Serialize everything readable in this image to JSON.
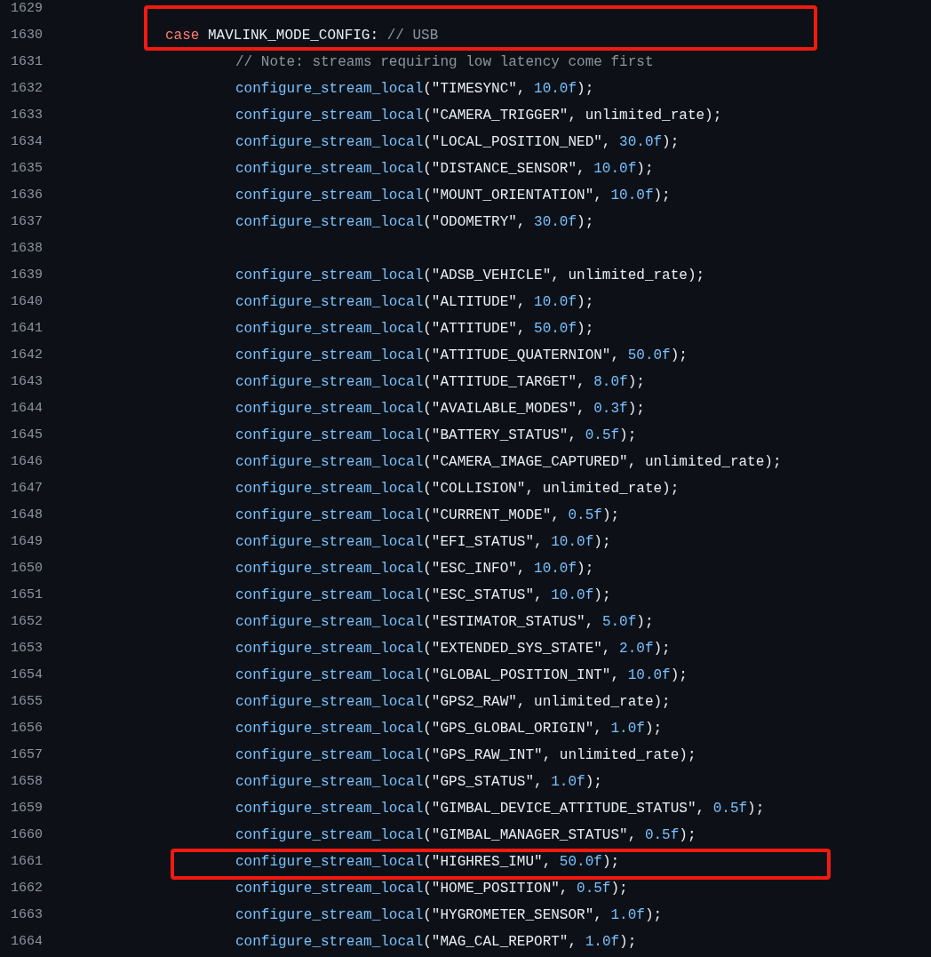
{
  "lines": [
    {
      "number": "1629",
      "highlighted": false
    },
    {
      "number": "1630",
      "highlighted": true,
      "tokens": [
        {
          "kind": "keyword",
          "text": "case"
        },
        {
          "kind": "plain",
          "text": " MAVLINK_MODE_CONFIG: "
        },
        {
          "kind": "comment",
          "text": "// USB"
        }
      ],
      "children": [
        {
          "number": "1631",
          "highlighted": false,
          "tokens": [
            {
              "kind": "comment",
              "text": "// Note: streams requiring low latency come first"
            }
          ]
        },
        {
          "number": "1632",
          "highlighted": false,
          "tokens": [
            {
              "kind": "function",
              "text": "configure_stream_local"
            },
            {
              "kind": "plain",
              "text": "(\"TIMESYNC\", "
            },
            {
              "kind": "number",
              "text": "10.0f"
            },
            {
              "kind": "plain",
              "text": ");"
            }
          ]
        },
        {
          "number": "1633",
          "highlighted": false,
          "tokens": [
            {
              "kind": "function",
              "text": "configure_stream_local"
            },
            {
              "kind": "plain",
              "text": "(\"CAMERA_TRIGGER\", unlimited_rate);"
            }
          ]
        },
        {
          "number": "1634",
          "highlighted": false,
          "tokens": [
            {
              "kind": "function",
              "text": "configure_stream_local"
            },
            {
              "kind": "plain",
              "text": "(\"LOCAL_POSITION_NED\", "
            },
            {
              "kind": "number",
              "text": "30.0f"
            },
            {
              "kind": "plain",
              "text": ");"
            }
          ]
        },
        {
          "number": "1635",
          "highlighted": false,
          "tokens": [
            {
              "kind": "function",
              "text": "configure_stream_local"
            },
            {
              "kind": "plain",
              "text": "(\"DISTANCE_SENSOR\", "
            },
            {
              "kind": "number",
              "text": "10.0f"
            },
            {
              "kind": "plain",
              "text": ");"
            }
          ]
        },
        {
          "number": "1636",
          "highlighted": false,
          "tokens": [
            {
              "kind": "function",
              "text": "configure_stream_local"
            },
            {
              "kind": "plain",
              "text": "(\"MOUNT_ORIENTATION\", "
            },
            {
              "kind": "number",
              "text": "10.0f"
            },
            {
              "kind": "plain",
              "text": ");"
            }
          ]
        },
        {
          "number": "1637",
          "highlighted": false,
          "tokens": [
            {
              "kind": "function",
              "text": "configure_stream_local"
            },
            {
              "kind": "plain",
              "text": "(\"ODOMETRY\", "
            },
            {
              "kind": "number",
              "text": "30.0f"
            },
            {
              "kind": "plain",
              "text": ");"
            }
          ]
        },
        {
          "number": "1638",
          "highlighted": false
        },
        {
          "number": "1639",
          "highlighted": false,
          "tokens": [
            {
              "kind": "function",
              "text": "configure_stream_local"
            },
            {
              "kind": "plain",
              "text": "(\"ADSB_VEHICLE\", unlimited_rate);"
            }
          ]
        },
        {
          "number": "1640",
          "highlighted": false,
          "tokens": [
            {
              "kind": "function",
              "text": "configure_stream_local"
            },
            {
              "kind": "plain",
              "text": "(\"ALTITUDE\", "
            },
            {
              "kind": "number",
              "text": "10.0f"
            },
            {
              "kind": "plain",
              "text": ");"
            }
          ]
        },
        {
          "number": "1641",
          "highlighted": false,
          "tokens": [
            {
              "kind": "function",
              "text": "configure_stream_local"
            },
            {
              "kind": "plain",
              "text": "(\"ATTITUDE\", "
            },
            {
              "kind": "number",
              "text": "50.0f"
            },
            {
              "kind": "plain",
              "text": ");"
            }
          ]
        },
        {
          "number": "1642",
          "highlighted": false,
          "tokens": [
            {
              "kind": "function",
              "text": "configure_stream_local"
            },
            {
              "kind": "plain",
              "text": "(\"ATTITUDE_QUATERNION\", "
            },
            {
              "kind": "number",
              "text": "50.0f"
            },
            {
              "kind": "plain",
              "text": ");"
            }
          ]
        },
        {
          "number": "1643",
          "highlighted": false,
          "tokens": [
            {
              "kind": "function",
              "text": "configure_stream_local"
            },
            {
              "kind": "plain",
              "text": "(\"ATTITUDE_TARGET\", "
            },
            {
              "kind": "number",
              "text": "8.0f"
            },
            {
              "kind": "plain",
              "text": ");"
            }
          ]
        },
        {
          "number": "1644",
          "highlighted": false,
          "tokens": [
            {
              "kind": "function",
              "text": "configure_stream_local"
            },
            {
              "kind": "plain",
              "text": "(\"AVAILABLE_MODES\", "
            },
            {
              "kind": "number",
              "text": "0.3f"
            },
            {
              "kind": "plain",
              "text": ");"
            }
          ]
        },
        {
          "number": "1645",
          "highlighted": false,
          "tokens": [
            {
              "kind": "function",
              "text": "configure_stream_local"
            },
            {
              "kind": "plain",
              "text": "(\"BATTERY_STATUS\", "
            },
            {
              "kind": "number",
              "text": "0.5f"
            },
            {
              "kind": "plain",
              "text": ");"
            }
          ]
        },
        {
          "number": "1646",
          "highlighted": false,
          "tokens": [
            {
              "kind": "function",
              "text": "configure_stream_local"
            },
            {
              "kind": "plain",
              "text": "(\"CAMERA_IMAGE_CAPTURED\", unlimited_rate);"
            }
          ]
        },
        {
          "number": "1647",
          "highlighted": false,
          "tokens": [
            {
              "kind": "function",
              "text": "configure_stream_local"
            },
            {
              "kind": "plain",
              "text": "(\"COLLISION\", unlimited_rate);"
            }
          ]
        },
        {
          "number": "1648",
          "highlighted": false,
          "tokens": [
            {
              "kind": "function",
              "text": "configure_stream_local"
            },
            {
              "kind": "plain",
              "text": "(\"CURRENT_MODE\", "
            },
            {
              "kind": "number",
              "text": "0.5f"
            },
            {
              "kind": "plain",
              "text": ");"
            }
          ]
        },
        {
          "number": "1649",
          "highlighted": false,
          "tokens": [
            {
              "kind": "function",
              "text": "configure_stream_local"
            },
            {
              "kind": "plain",
              "text": "(\"EFI_STATUS\", "
            },
            {
              "kind": "number",
              "text": "10.0f"
            },
            {
              "kind": "plain",
              "text": ");"
            }
          ]
        },
        {
          "number": "1650",
          "highlighted": false,
          "tokens": [
            {
              "kind": "function",
              "text": "configure_stream_local"
            },
            {
              "kind": "plain",
              "text": "(\"ESC_INFO\", "
            },
            {
              "kind": "number",
              "text": "10.0f"
            },
            {
              "kind": "plain",
              "text": ");"
            }
          ]
        },
        {
          "number": "1651",
          "highlighted": false,
          "tokens": [
            {
              "kind": "function",
              "text": "configure_stream_local"
            },
            {
              "kind": "plain",
              "text": "(\"ESC_STATUS\", "
            },
            {
              "kind": "number",
              "text": "10.0f"
            },
            {
              "kind": "plain",
              "text": ");"
            }
          ]
        },
        {
          "number": "1652",
          "highlighted": false,
          "tokens": [
            {
              "kind": "function",
              "text": "configure_stream_local"
            },
            {
              "kind": "plain",
              "text": "(\"ESTIMATOR_STATUS\", "
            },
            {
              "kind": "number",
              "text": "5.0f"
            },
            {
              "kind": "plain",
              "text": ");"
            }
          ]
        },
        {
          "number": "1653",
          "highlighted": false,
          "tokens": [
            {
              "kind": "function",
              "text": "configure_stream_local"
            },
            {
              "kind": "plain",
              "text": "(\"EXTENDED_SYS_STATE\", "
            },
            {
              "kind": "number",
              "text": "2.0f"
            },
            {
              "kind": "plain",
              "text": ");"
            }
          ]
        },
        {
          "number": "1654",
          "highlighted": false,
          "tokens": [
            {
              "kind": "function",
              "text": "configure_stream_local"
            },
            {
              "kind": "plain",
              "text": "(\"GLOBAL_POSITION_INT\", "
            },
            {
              "kind": "number",
              "text": "10.0f"
            },
            {
              "kind": "plain",
              "text": ");"
            }
          ]
        },
        {
          "number": "1655",
          "highlighted": false,
          "tokens": [
            {
              "kind": "function",
              "text": "configure_stream_local"
            },
            {
              "kind": "plain",
              "text": "(\"GPS2_RAW\", unlimited_rate);"
            }
          ]
        },
        {
          "number": "1656",
          "highlighted": false,
          "tokens": [
            {
              "kind": "function",
              "text": "configure_stream_local"
            },
            {
              "kind": "plain",
              "text": "(\"GPS_GLOBAL_ORIGIN\", "
            },
            {
              "kind": "number",
              "text": "1.0f"
            },
            {
              "kind": "plain",
              "text": ");"
            }
          ]
        },
        {
          "number": "1657",
          "highlighted": false,
          "tokens": [
            {
              "kind": "function",
              "text": "configure_stream_local"
            },
            {
              "kind": "plain",
              "text": "(\"GPS_RAW_INT\", unlimited_rate);"
            }
          ]
        },
        {
          "number": "1658",
          "highlighted": false,
          "tokens": [
            {
              "kind": "function",
              "text": "configure_stream_local"
            },
            {
              "kind": "plain",
              "text": "(\"GPS_STATUS\", "
            },
            {
              "kind": "number",
              "text": "1.0f"
            },
            {
              "kind": "plain",
              "text": ");"
            }
          ]
        },
        {
          "number": "1659",
          "highlighted": false,
          "tokens": [
            {
              "kind": "function",
              "text": "configure_stream_local"
            },
            {
              "kind": "plain",
              "text": "(\"GIMBAL_DEVICE_ATTITUDE_STATUS\", "
            },
            {
              "kind": "number",
              "text": "0.5f"
            },
            {
              "kind": "plain",
              "text": ");"
            }
          ]
        },
        {
          "number": "1660",
          "highlighted": false,
          "tokens": [
            {
              "kind": "function",
              "text": "configure_stream_local"
            },
            {
              "kind": "plain",
              "text": "(\"GIMBAL_MANAGER_STATUS\", "
            },
            {
              "kind": "number",
              "text": "0.5f"
            },
            {
              "kind": "plain",
              "text": ");"
            }
          ]
        },
        {
          "number": "1661",
          "highlighted": true,
          "tokens": [
            {
              "kind": "function",
              "text": "configure_stream_local"
            },
            {
              "kind": "plain",
              "text": "(\"HIGHRES_IMU\", "
            },
            {
              "kind": "number",
              "text": "50.0f"
            },
            {
              "kind": "plain",
              "text": ");"
            }
          ]
        },
        {
          "number": "1662",
          "highlighted": false,
          "tokens": [
            {
              "kind": "function",
              "text": "configure_stream_local"
            },
            {
              "kind": "plain",
              "text": "(\"HOME_POSITION\", "
            },
            {
              "kind": "number",
              "text": "0.5f"
            },
            {
              "kind": "plain",
              "text": ");"
            }
          ]
        },
        {
          "number": "1663",
          "highlighted": false,
          "tokens": [
            {
              "kind": "function",
              "text": "configure_stream_local"
            },
            {
              "kind": "plain",
              "text": "(\"HYGROMETER_SENSOR\", "
            },
            {
              "kind": "number",
              "text": "1.0f"
            },
            {
              "kind": "plain",
              "text": ");"
            }
          ]
        },
        {
          "number": "1664",
          "highlighted": false,
          "tokens": [
            {
              "kind": "function",
              "text": "configure_stream_local"
            },
            {
              "kind": "plain",
              "text": "(\"MAG_CAL_REPORT\", "
            },
            {
              "kind": "number",
              "text": "1.0f"
            },
            {
              "kind": "plain",
              "text": ");"
            }
          ]
        }
      ]
    }
  ]
}
